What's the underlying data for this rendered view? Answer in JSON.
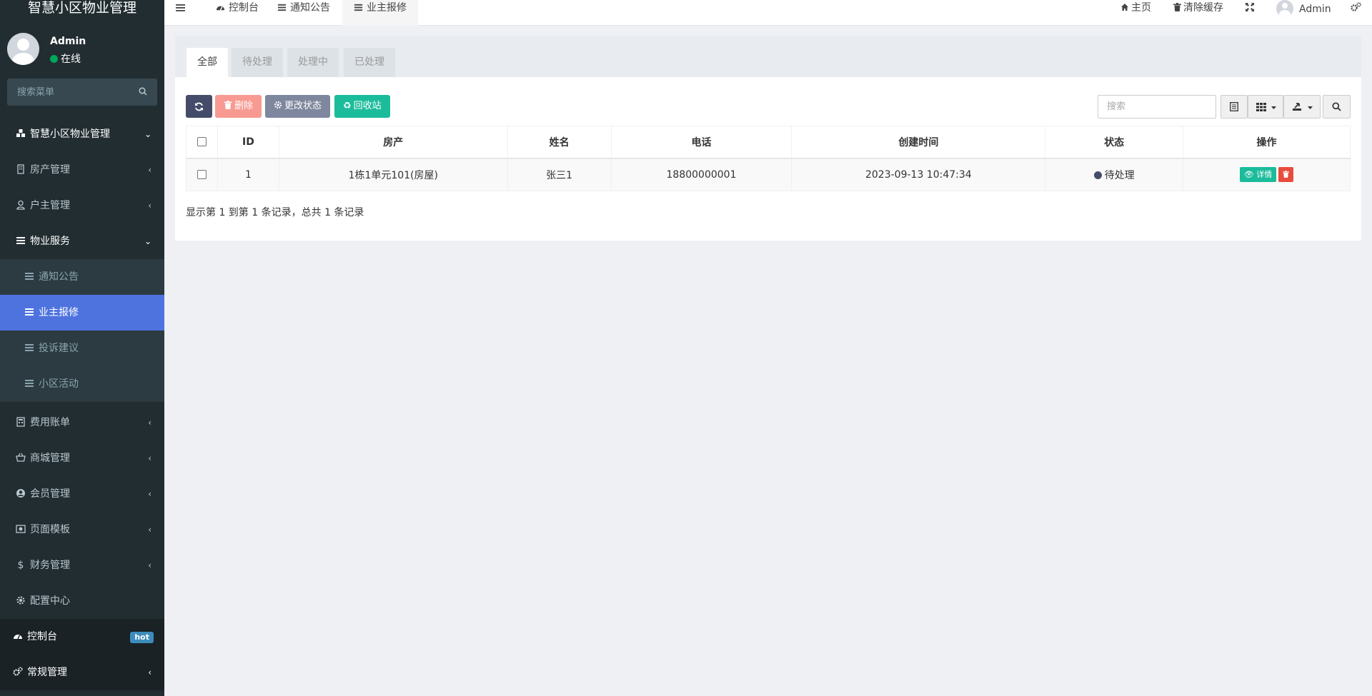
{
  "sidebar": {
    "brand": "智慧小区物业管理",
    "user": {
      "name": "Admin",
      "status": "在线"
    },
    "search_placeholder": "搜索菜单",
    "items": [
      {
        "label": "智慧小区物业管理"
      },
      {
        "label": "房产管理"
      },
      {
        "label": "户主管理"
      },
      {
        "label": "物业服务"
      },
      {
        "label": "通知公告"
      },
      {
        "label": "业主报修"
      },
      {
        "label": "投诉建议"
      },
      {
        "label": "小区活动"
      },
      {
        "label": "费用账单"
      },
      {
        "label": "商城管理"
      },
      {
        "label": "会员管理"
      },
      {
        "label": "页面模板"
      },
      {
        "label": "财务管理"
      },
      {
        "label": "配置中心"
      }
    ],
    "bottom": [
      {
        "label": "控制台",
        "badge": "hot"
      },
      {
        "label": "常规管理"
      }
    ]
  },
  "topnav": {
    "tabs": [
      {
        "label": "控制台"
      },
      {
        "label": "通知公告"
      },
      {
        "label": "业主报修"
      }
    ],
    "home": "主页",
    "clear_cache": "清除缓存",
    "user": "Admin"
  },
  "panel": {
    "tabs": [
      {
        "label": "全部"
      },
      {
        "label": "待处理"
      },
      {
        "label": "处理中"
      },
      {
        "label": "已处理"
      }
    ],
    "toolbar": {
      "delete": "删除",
      "change_status": "更改状态",
      "recycle": "回收站"
    },
    "search_placeholder": "搜索",
    "table": {
      "columns": [
        "ID",
        "房产",
        "姓名",
        "电话",
        "创建时间",
        "状态",
        "操作"
      ],
      "rows": [
        {
          "id": "1",
          "property": "1栋1单元101(房屋)",
          "name": "张三1",
          "phone": "18800000001",
          "created": "2023-09-13 10:47:34",
          "status": "待处理"
        }
      ],
      "view_label": "详情"
    },
    "page_info": "显示第 1 到第 1 条记录，总共 1 条记录"
  },
  "colors": {
    "sidebar_bg": "#222d32",
    "active_item": "#4e73df",
    "success": "#1bbc9b",
    "danger": "#e74c3c"
  }
}
